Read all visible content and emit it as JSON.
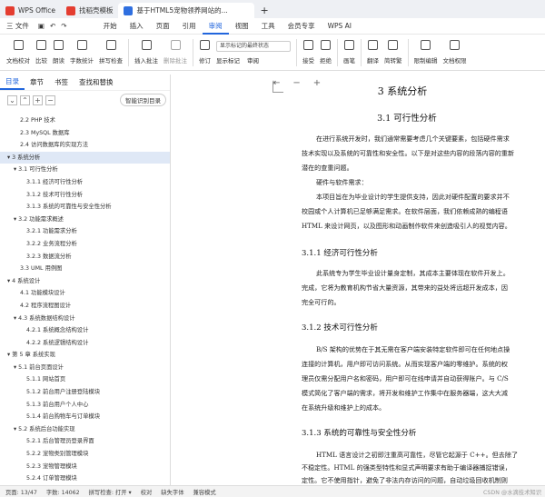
{
  "titlebar": {
    "tabs": [
      "WPS Office",
      "找稻壳模板",
      "基于HTML5宠物领养网站的..."
    ],
    "logo_color": "#e43d30"
  },
  "menubar": {
    "items": [
      "三 文件",
      "开始",
      "插入",
      "页面",
      "引用",
      "审阅",
      "视图",
      "工具",
      "会员专享",
      "WPS AI"
    ],
    "active": "审阅"
  },
  "ribbon": {
    "buttons": [
      "文档校对",
      "比较",
      "朗读",
      "字数统计",
      "拼写检查",
      "插入批注",
      "删除批注",
      "修订",
      "显示标记",
      "审阅",
      "接受",
      "拒绝",
      "画笔",
      "翻译",
      "简转繁",
      "限制编辑",
      "文档权限"
    ],
    "dropdown": "显示标记的最终状态"
  },
  "leftpanel": {
    "tabs": [
      "目录",
      "章节",
      "书签",
      "查找和替换"
    ],
    "smart_button": "智能识别目录",
    "toc": [
      {
        "text": "2.2 PHP 技术",
        "indent": 2
      },
      {
        "text": "2.3 MySQL 数据库",
        "indent": 2
      },
      {
        "text": "2.4 访问数据库的实现方法",
        "indent": 2
      },
      {
        "text": "▾ 3 系统分析",
        "indent": 0,
        "selected": true
      },
      {
        "text": "▾ 3.1 可行性分析",
        "indent": 1
      },
      {
        "text": "3.1.1 经济可行性分析",
        "indent": 3
      },
      {
        "text": "3.1.2 技术可行性分析",
        "indent": 3
      },
      {
        "text": "3.1.3 系统的可靠性与安全性分析",
        "indent": 3
      },
      {
        "text": "▾ 3.2 功能需求概述",
        "indent": 1
      },
      {
        "text": "3.2.1 功能需求分析",
        "indent": 3
      },
      {
        "text": "3.2.2 业务流程分析",
        "indent": 3
      },
      {
        "text": "3.2.3 数据流分析",
        "indent": 3
      },
      {
        "text": "3.3 UML 用例图",
        "indent": 2
      },
      {
        "text": "▾ 4 系统设计",
        "indent": 0
      },
      {
        "text": "4.1 功能模块设计",
        "indent": 2
      },
      {
        "text": "4.2 程序流程图设计",
        "indent": 2
      },
      {
        "text": "▾ 4.3 系统数据结构设计",
        "indent": 1
      },
      {
        "text": "4.2.1 系统概念结构设计",
        "indent": 3
      },
      {
        "text": "4.2.2 系统逻辑结构设计",
        "indent": 3
      },
      {
        "text": "▾ 第 5 章 系统实现",
        "indent": 0
      },
      {
        "text": "▾ 5.1 前台页面设计",
        "indent": 1
      },
      {
        "text": "5.1.1 网站首页",
        "indent": 3
      },
      {
        "text": "5.1.2 前台用户注册登陆模块",
        "indent": 3
      },
      {
        "text": "5.1.3 前台用户个人中心",
        "indent": 3
      },
      {
        "text": "5.1.4 前台购物车与订单模块",
        "indent": 3
      },
      {
        "text": "▾ 5.2 系统后台功能实现",
        "indent": 1
      },
      {
        "text": "5.2.1 后台管理员登录界面",
        "indent": 3
      },
      {
        "text": "5.2.2 宠物类别管理模块",
        "indent": 3
      },
      {
        "text": "5.2.3 宠物管理模块",
        "indent": 3
      },
      {
        "text": "5.2.4 订单管理模块",
        "indent": 3
      }
    ]
  },
  "doc": {
    "h1": "3  系统分析",
    "h2": "3.1  可行性分析",
    "p1a": "在进行系统开发时，我们通常需要考虑几个关键要素，包括硬件需求",
    "p1b": "技术实现以及系统的可靠性和安全性。以下是对这些内容的段落内容的重新",
    "p1c": "潜在的查重问题。",
    "p2": "硬件与软件需求：",
    "p3a": "本项目旨在为毕业设计的学生提供支持，因此对硬件配置的要求并不",
    "p3b": "校园或个人计算机已足够满足需求。在软件层面，我们依赖成熟的编程语",
    "p3c": "HTML 来设计网页，以及图形和动画制作软件来创造吸引人的视觉内容。",
    "h3a": "3.1.1  经济可行性分析",
    "p4a": "此系统专为学生毕业设计量身定制，其成本主要体现在软件开发上。",
    "p4b": "完成，它将为教育机构节省大量资源，其带来的益处将远超开发成本，因",
    "p4c": "完全可行的。",
    "h3b": "3.1.2  技术可行性分析",
    "p5a": "B/S 架构的优势在于其无需在客户端安装特定软件即可在任何地点操",
    "p5b": "连接的计算机，用户即可访问系统。从而实现客户端的零维护。系统的权",
    "p5c": "理员仅需分配用户名和密码，用户即可在线申请并自动获得账户。与 C/S",
    "p5d": "模式简化了客户端的需求，将开发和维护工作集中在服务器端，这大大减",
    "p5e": "在系统升级和维护上的成本。",
    "h3c": "3.1.3  系统的可靠性与安全性分析",
    "p6a": "HTML 语言设计之初即注重高可靠性，尽管它起源于 C++。但去除了",
    "p6b": "不稳定性。HTML 的强类型特性和显式声明要求有助于编译器捕捉错误，",
    "p6c": "定性。它不使用指针，避免了非法内存访问的问题，自动垃圾回收机制则"
  },
  "statusbar": {
    "items": [
      "页面: 13/47",
      "字数: 14062",
      "拼写检查: 打开 ▾",
      "校对",
      "缺失字体",
      "兼容模式"
    ],
    "watermark": "CSDN @水滴技术知识"
  }
}
